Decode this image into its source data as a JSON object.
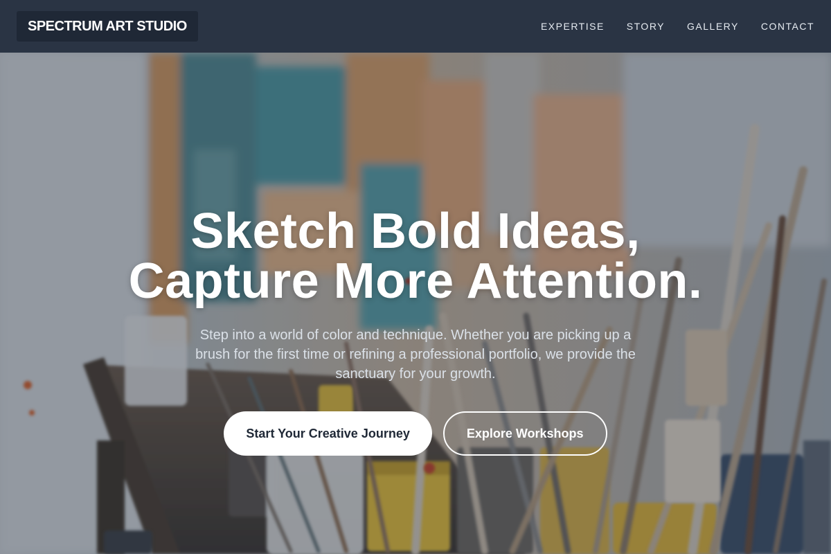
{
  "brand": {
    "name": "SPECTRUM ART STUDIO"
  },
  "nav": {
    "items": [
      {
        "label": "EXPERTISE"
      },
      {
        "label": "STORY"
      },
      {
        "label": "GALLERY"
      },
      {
        "label": "CONTACT"
      }
    ]
  },
  "hero": {
    "title_line1": "Sketch Bold Ideas,",
    "title_line2": "Capture More Attention.",
    "subtitle": "Step into a world of color and technique. Whether you are picking up a brush for the first time or refining a professional portfolio, we provide the sanctuary for your growth.",
    "primary_cta": "Start Your Creative Journey",
    "secondary_cta": "Explore Workshops",
    "background_image": "art-studio-paint-brushes-photo"
  },
  "colors": {
    "navbar_bg": "#2a3444",
    "brand_bg": "#1f2836",
    "overlay": "#222a38",
    "primary_button_bg": "#ffffff",
    "primary_button_text": "#1f2836"
  }
}
